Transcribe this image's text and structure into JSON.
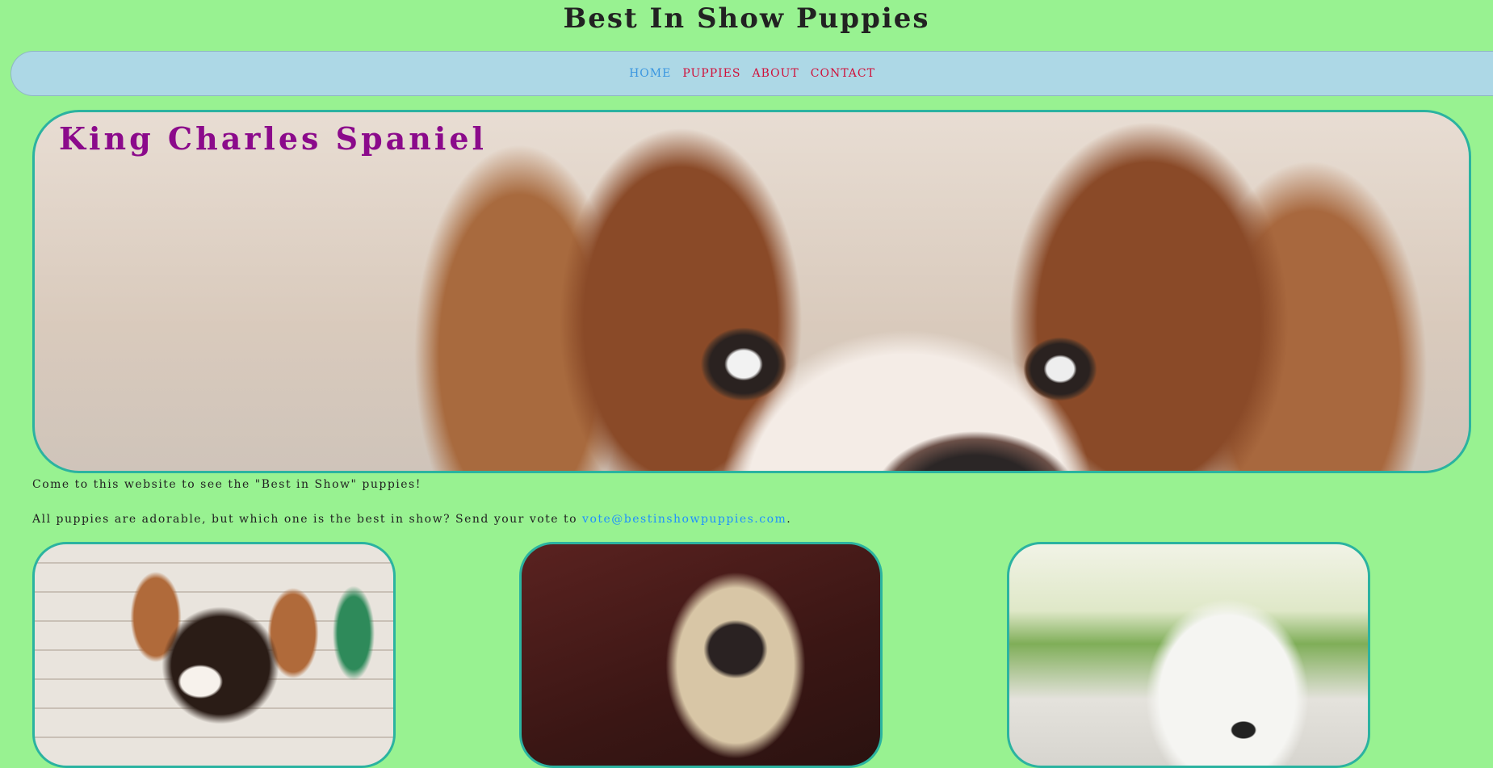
{
  "site": {
    "title": "Best In Show Puppies"
  },
  "nav": {
    "items": [
      {
        "label": "HOME"
      },
      {
        "label": "PUPPIES"
      },
      {
        "label": "ABOUT"
      },
      {
        "label": "CONTACT"
      }
    ],
    "active": "HOME"
  },
  "hero": {
    "title": "King Charles Spaniel"
  },
  "intro": {
    "line1": "Come to this website to see the \"Best in Show\" puppies!",
    "line2_prefix": "All puppies are adorable, but which one is the best in show? Send your vote to ",
    "email": "vote@bestinshowpuppies.com",
    "line2_suffix": "."
  },
  "colors": {
    "background": "#98f291",
    "nav_background": "#add8e6",
    "nav_link": "#d0103a",
    "nav_active": "#3a96e0",
    "hero_title": "#8b0a8b",
    "card_border": "#2bb3a0",
    "link": "#1e90ff"
  }
}
